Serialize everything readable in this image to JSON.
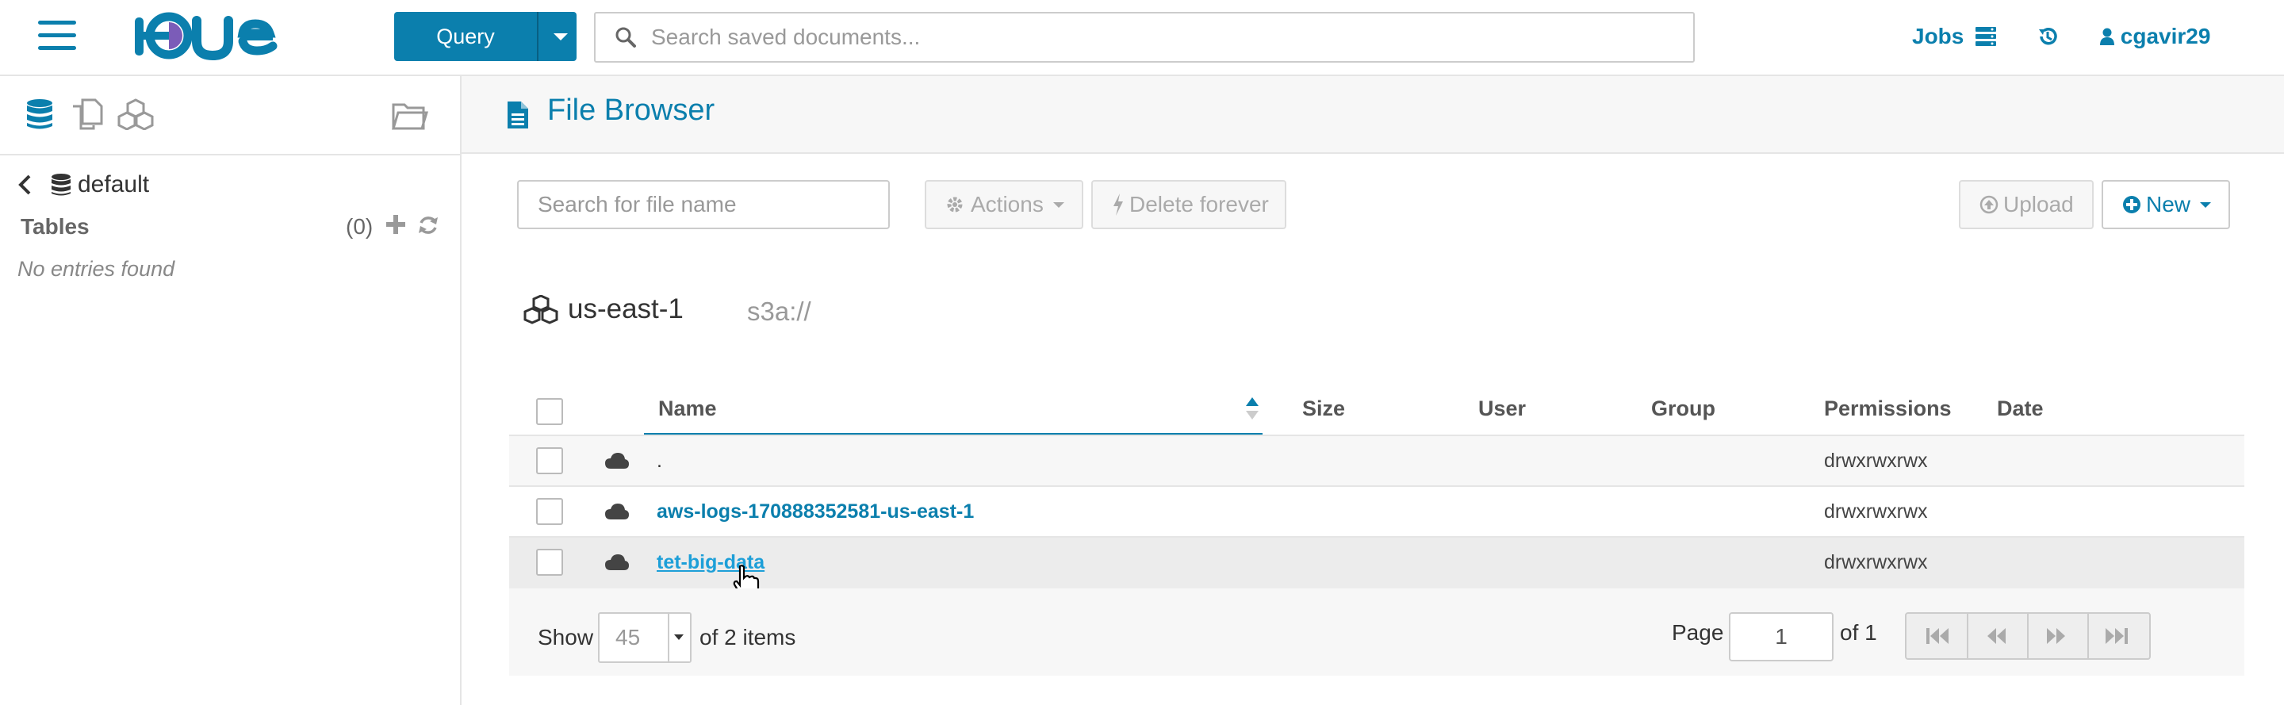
{
  "topbar": {
    "query_label": "Query",
    "search_placeholder": "Search saved documents...",
    "jobs_label": "Jobs",
    "user_label": "cgavir29",
    "brand_color": "#0B7FAD"
  },
  "sidebar": {
    "database": "default",
    "tables_label": "Tables",
    "tables_count": "(0)",
    "empty_label": "No entries found"
  },
  "content": {
    "title": "File Browser",
    "file_search_placeholder": "Search for file name",
    "actions_label": "Actions",
    "delete_label": "Delete forever",
    "upload_label": "Upload",
    "new_label": "New",
    "bucket_name": "us-east-1",
    "bucket_path": "s3a://",
    "columns": [
      "Name",
      "Size",
      "User",
      "Group",
      "Permissions",
      "Date"
    ],
    "rows": [
      {
        "name": ".",
        "permissions": "drwxrwxrwx"
      },
      {
        "name": "aws-logs-170888352581-us-east-1",
        "permissions": "drwxrwxrwx"
      },
      {
        "name": "tet-big-data",
        "permissions": "drwxrwxrwx"
      }
    ],
    "show_label": "Show",
    "page_size": "45",
    "items_label": "of 2 items",
    "page_label": "Page",
    "page_value": "1",
    "page_total": "of 1"
  }
}
